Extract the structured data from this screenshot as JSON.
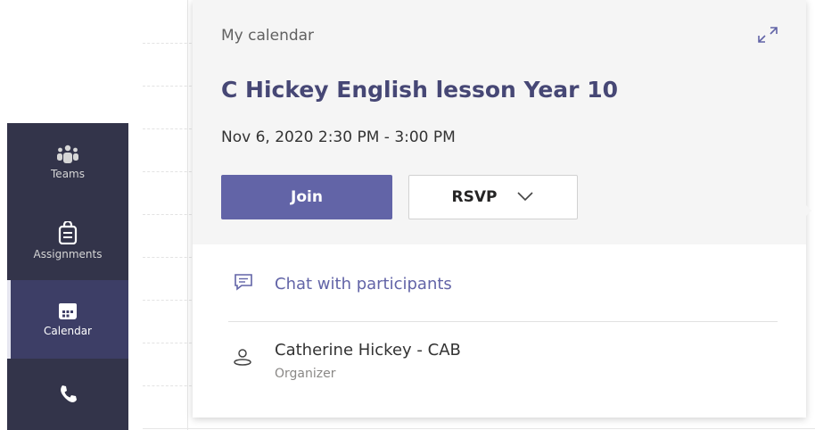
{
  "rail": {
    "items": [
      {
        "label": "Teams",
        "icon": "teams-icon",
        "active": false
      },
      {
        "label": "Assignments",
        "icon": "assignments-icon",
        "active": false
      },
      {
        "label": "Calendar",
        "icon": "calendar-icon",
        "active": true
      },
      {
        "label": "",
        "icon": "phone-icon",
        "active": false
      }
    ]
  },
  "popup": {
    "calendar_name": "My calendar",
    "title": "C Hickey English lesson Year 10",
    "when": "Nov 6, 2020 2:30 PM - 3:00 PM",
    "join_label": "Join",
    "rsvp_label": "RSVP",
    "chat_label": "Chat with participants",
    "organizer_name": "Catherine Hickey - CAB",
    "organizer_role": "Organizer"
  },
  "colors": {
    "accent": "#6264a7",
    "title": "#464775",
    "rail": "#33344a"
  }
}
